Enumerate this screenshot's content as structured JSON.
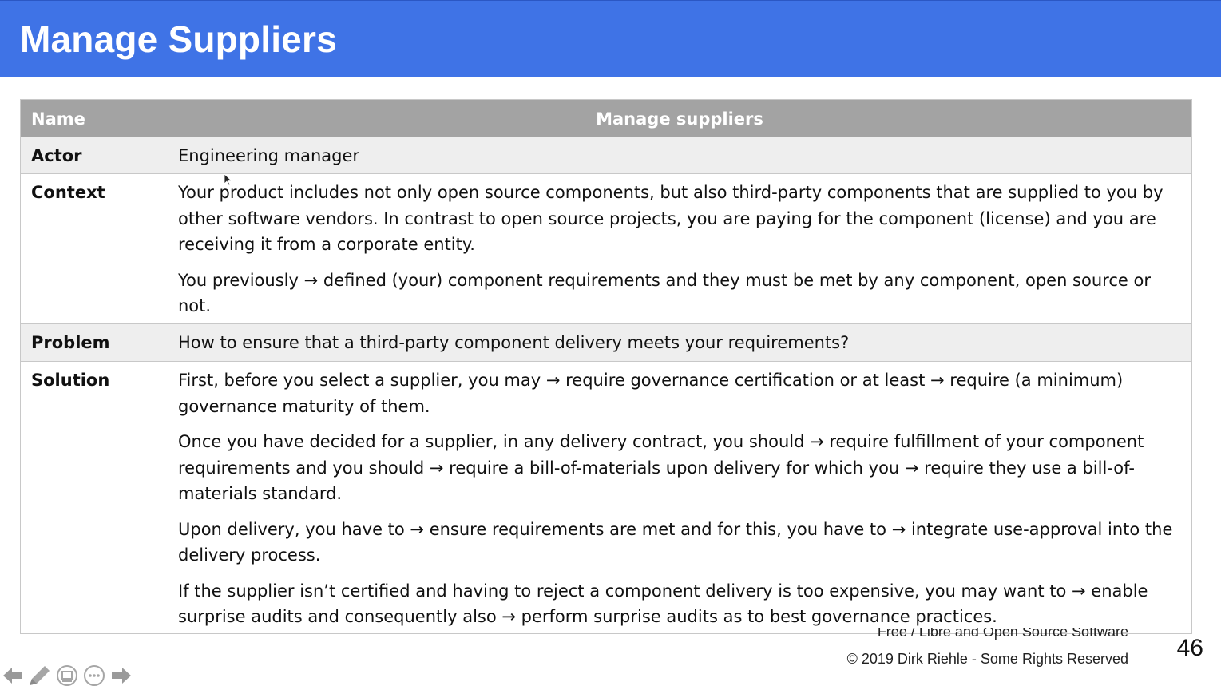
{
  "slide": {
    "title": "Manage Suppliers",
    "page_number": "46",
    "footer_line1": "Free / Libre and Open Source Software",
    "footer_line2": "© 2019 Dirk Riehle - Some Rights Reserved"
  },
  "table": {
    "header": {
      "key": "Name",
      "value": "Manage suppliers"
    },
    "actor": {
      "key": "Actor",
      "value": "Engineering manager"
    },
    "context": {
      "key": "Context",
      "paragraphs": [
        "Your product includes not only open source components, but also third-party components that are supplied to you by other software vendors. In contrast to open source projects, you are paying for the component (license) and you are receiving it from a corporate entity.",
        "You previously → defined (your) component requirements and they must be met by any component, open source or not."
      ]
    },
    "problem": {
      "key": "Problem",
      "value": "How to ensure that a third-party component delivery meets your requirements?"
    },
    "solution": {
      "key": "Solution",
      "paragraphs": [
        "First, before you select a supplier, you may → require governance certification or at least → require (a minimum) governance maturity of them.",
        "Once you have decided for a supplier, in any delivery contract, you should → require fulfillment of your component requirements and you should → require a bill-of-materials upon delivery for which you → require they use a bill-of-materials standard.",
        "Upon delivery, you have to → ensure requirements are met and for this, you have to → integrate use-approval into the delivery process.",
        "If the supplier isn’t certified and having to reject a component delivery is too expensive, you may want to → enable surprise audits and consequently also → perform surprise audits as to best governance practices."
      ]
    }
  },
  "nav_icons": [
    "previous-arrow-icon",
    "pen-icon",
    "slides-overview-icon",
    "more-options-icon",
    "next-arrow-icon"
  ],
  "colors": {
    "header_bg": "#3f73e6",
    "table_header_bg": "#a3a3a3",
    "row_shade": "#eeeeee"
  }
}
